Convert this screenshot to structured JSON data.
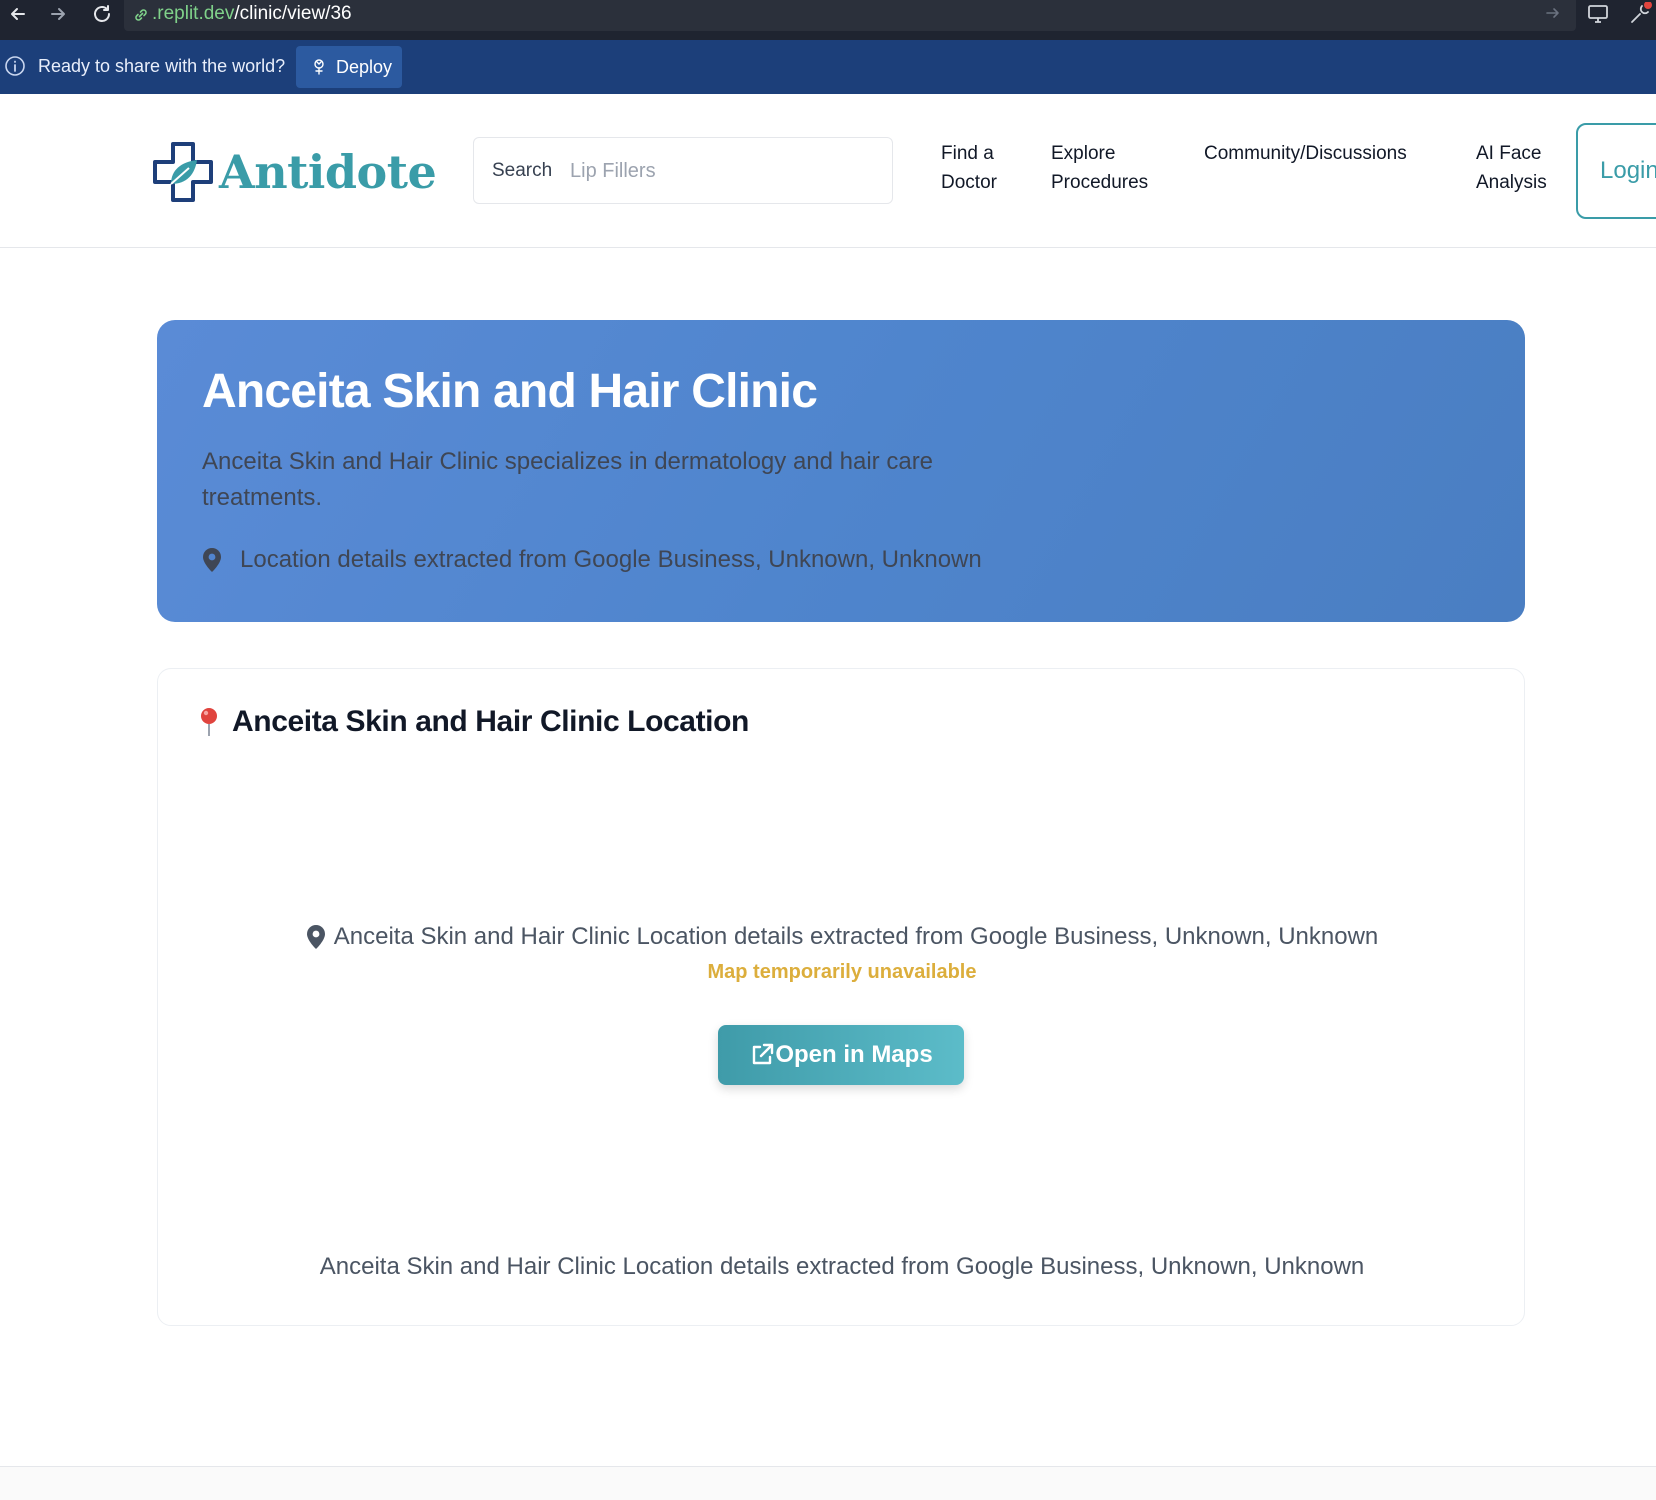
{
  "browser": {
    "url_host": ".replit.dev",
    "url_path": "/clinic/view/36"
  },
  "replit_banner": {
    "text": "Ready to share with the world?",
    "deploy_label": "Deploy"
  },
  "header": {
    "logo_text": "Antidote",
    "search_label": "Search",
    "search_placeholder": "Lip Fillers",
    "nav": [
      {
        "line1": "Find a",
        "line2": "Doctor"
      },
      {
        "line1": "Explore",
        "line2": "Procedures"
      },
      {
        "line1": "Community/Discussions",
        "line2": ""
      },
      {
        "line1": "AI Face",
        "line2": "Analysis"
      }
    ],
    "login_label": "Login"
  },
  "hero": {
    "title": "Anceita Skin and Hair Clinic",
    "description": "Anceita Skin and Hair Clinic specializes in dermatology and hair care treatments.",
    "location": "Location details extracted from Google Business, Unknown, Unknown"
  },
  "location_card": {
    "title": "Anceita Skin and Hair Clinic Location",
    "address": "Anceita Skin and Hair Clinic Location details extracted from Google Business, Unknown, Unknown",
    "map_warning": "Map temporarily unavailable",
    "open_maps_label": "Open in Maps",
    "footer_text": "Anceita Skin and Hair Clinic Location details extracted from Google Business, Unknown, Unknown"
  },
  "colors": {
    "brand_teal": "#3a9ca8",
    "hero_blue": "#4f85cd",
    "banner_blue": "#1c3f7a",
    "warning_yellow": "#dcae3c"
  }
}
